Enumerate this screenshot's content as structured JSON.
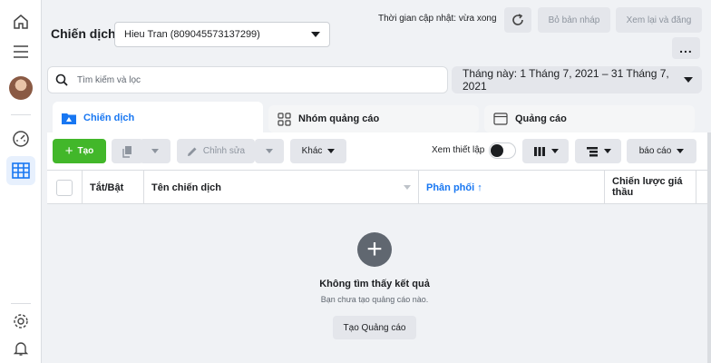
{
  "header": {
    "title": "Chiến dịch",
    "account": "Hieu Tran (809045573137299)",
    "updated": "Thời gian cập nhật: vừa xong",
    "draft_label": "Bỏ bản nháp",
    "review_label": "Xem lại và đăng",
    "more_label": "..."
  },
  "search": {
    "placeholder": "Tìm kiếm và lọc",
    "date_range": "Tháng này: 1 Tháng 7, 2021 – 31 Tháng 7, 2021"
  },
  "tabs": [
    {
      "label": "Chiến dịch",
      "icon": "folder-icon",
      "active": true
    },
    {
      "label": "Nhóm quảng cáo",
      "icon": "grid-icon",
      "active": false
    },
    {
      "label": "Quảng cáo",
      "icon": "ad-icon",
      "active": false
    }
  ],
  "toolbar": {
    "create": "Tạo",
    "edit": "Chỉnh sửa",
    "more": "Khác",
    "view_setup": "Xem thiết lập",
    "report": "báo cáo"
  },
  "table": {
    "columns": [
      "Tắt/Bật",
      "Tên chiến dịch",
      "Phân phối ↑",
      "Chiến lược giá thầu"
    ]
  },
  "empty_state": {
    "title": "Không tìm thấy kết quả",
    "subtitle": "Bạn chưa tạo quảng cáo nào.",
    "button": "Tạo Quảng cáo"
  },
  "colors": {
    "accent": "#1877f2",
    "create_green": "#42b72a"
  }
}
